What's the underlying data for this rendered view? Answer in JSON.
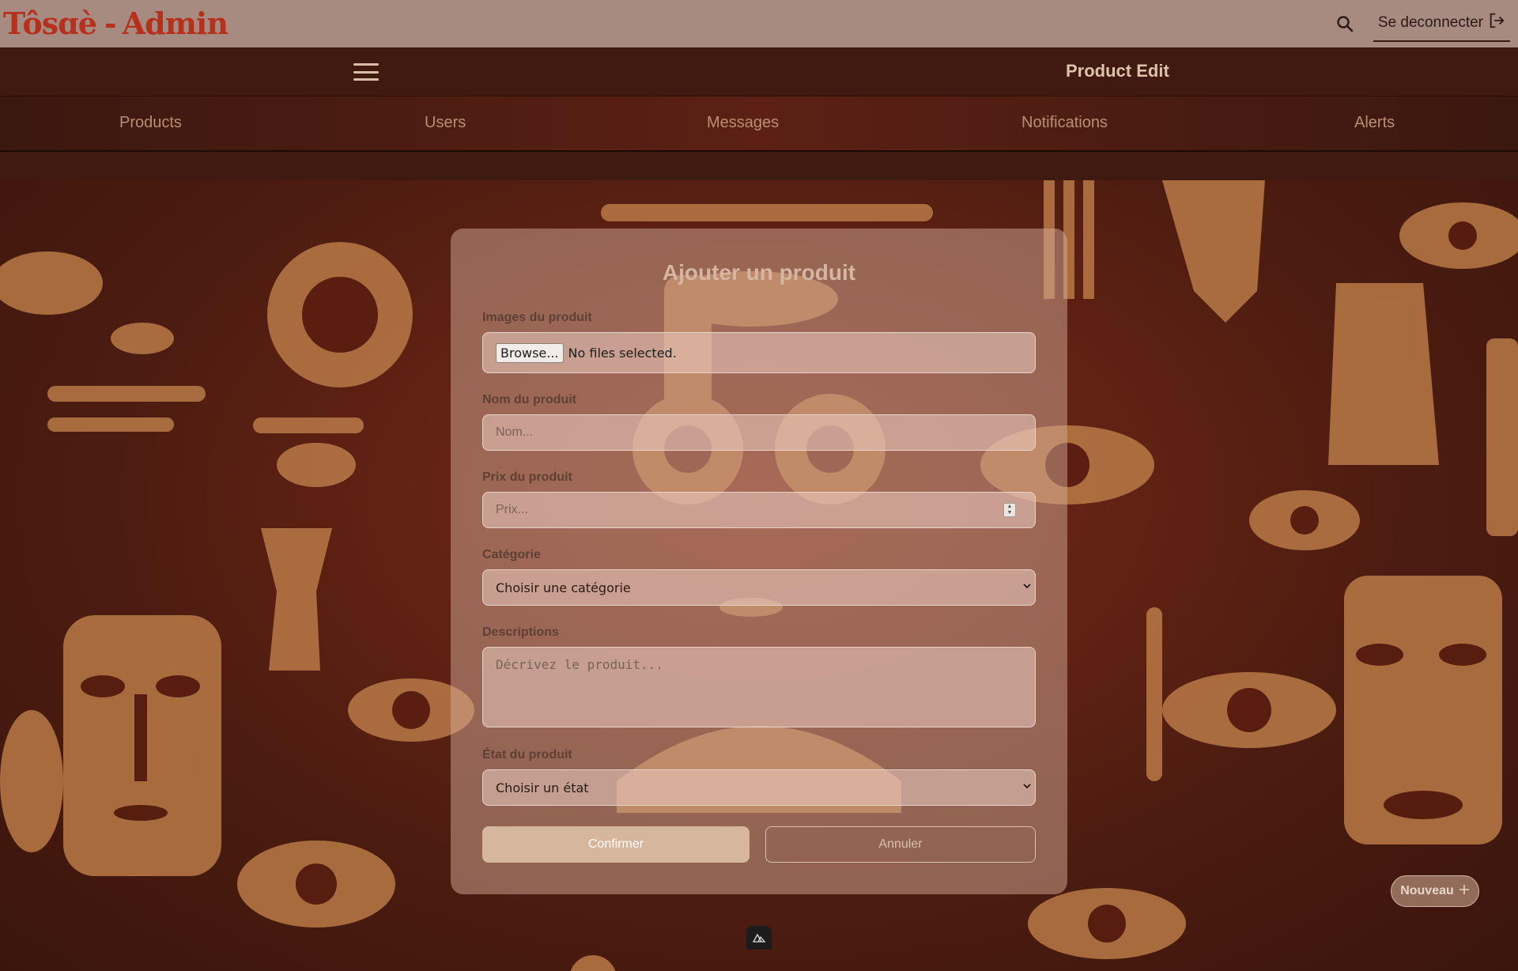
{
  "brand": {
    "name": "Tôsɑè",
    "sep": "-",
    "suffix": "Admin"
  },
  "topbar": {
    "logout_label": "Se deconnecter"
  },
  "header": {
    "title": "Product Edit"
  },
  "nav": {
    "items": [
      {
        "label": "Products"
      },
      {
        "label": "Users"
      },
      {
        "label": "Messages"
      },
      {
        "label": "Notifications"
      },
      {
        "label": "Alerts"
      }
    ]
  },
  "form": {
    "title": "Ajouter un produit",
    "images": {
      "label": "Images du produit",
      "browse": "Browse...",
      "status": "No files selected."
    },
    "name": {
      "label": "Nom du produit",
      "placeholder": "Nom..."
    },
    "price": {
      "label": "Prix du produit",
      "placeholder": "Prix..."
    },
    "category": {
      "label": "Catégorie",
      "value": "Choisir une catégorie"
    },
    "description": {
      "label": "Descriptions",
      "placeholder": "Décrivez le produit..."
    },
    "state": {
      "label": "État du produit",
      "value": "Choisir un état"
    },
    "confirm": "Confirmer",
    "cancel": "Annuler"
  },
  "fab": {
    "label": "Nouveau",
    "icon": "plus-icon"
  },
  "icons": [
    "search-icon",
    "logout-icon",
    "hamburger-icon",
    "chevron-down-icon",
    "nuxt-devtools-icon"
  ],
  "colors": {
    "topbar": "#a78a80",
    "brand": "#b7301c",
    "header": "#401a10",
    "pattern": "#b97a47",
    "card": "#d4aa96"
  }
}
